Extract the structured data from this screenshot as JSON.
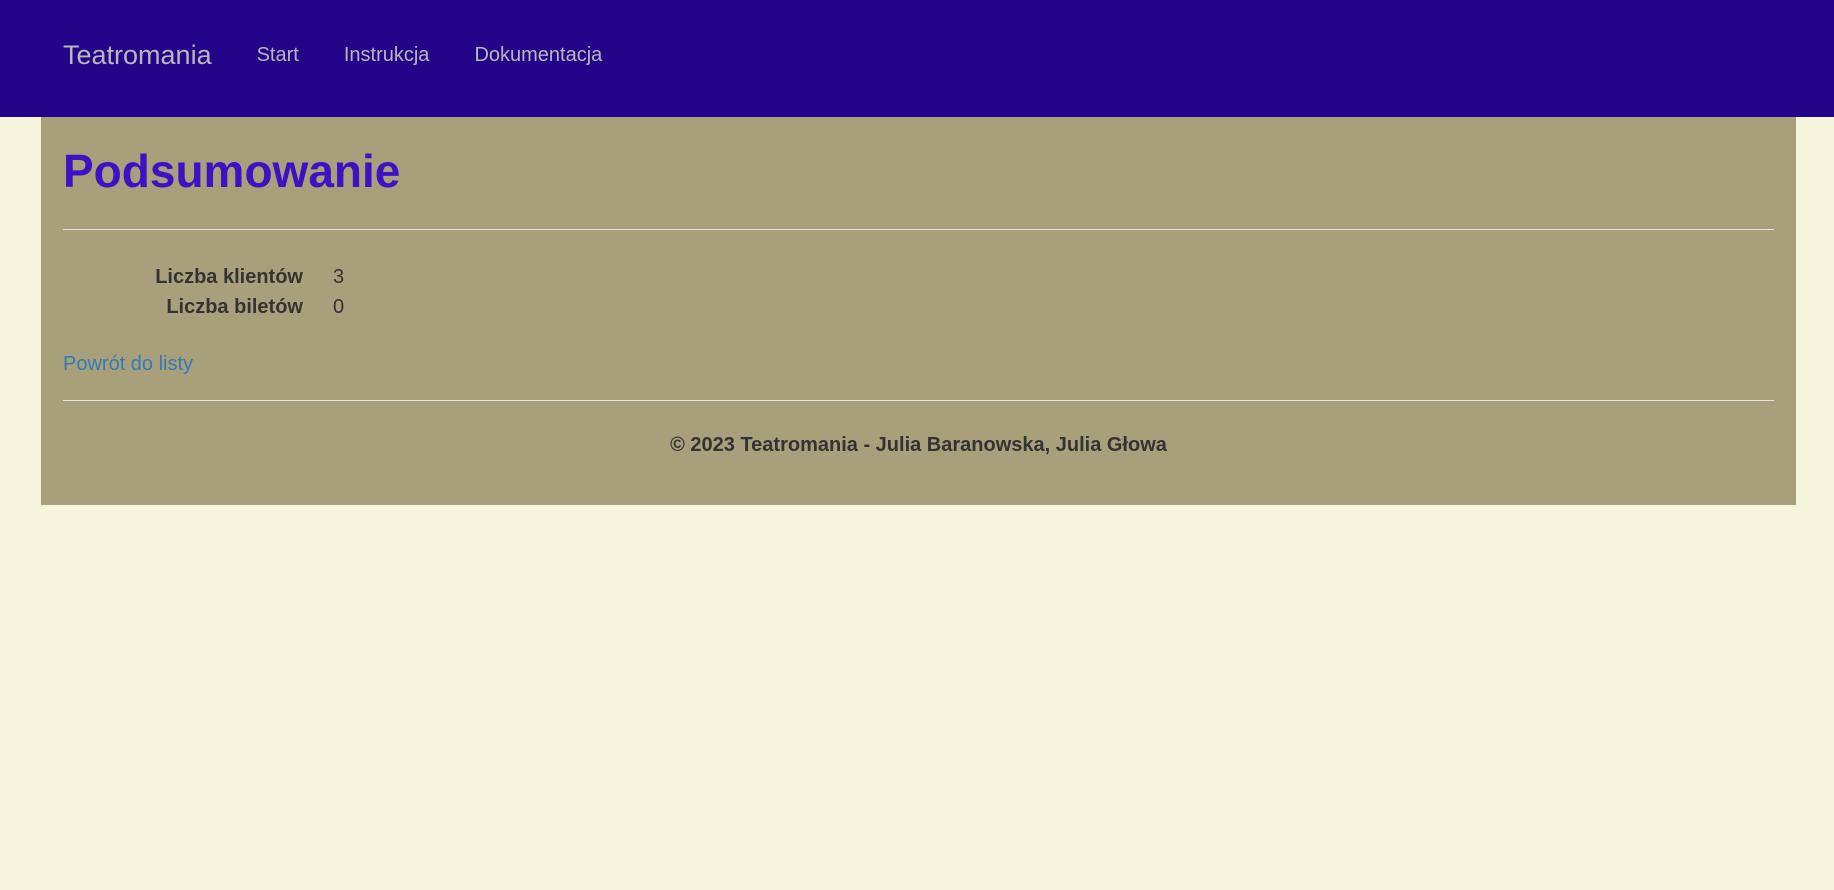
{
  "navbar": {
    "brand": "Teatromania",
    "links": [
      "Start",
      "Instrukcja",
      "Dokumentacja"
    ]
  },
  "main": {
    "title": "Podsumowanie",
    "details": [
      {
        "label": "Liczba klientów",
        "value": "3"
      },
      {
        "label": "Liczba biletów",
        "value": "0"
      }
    ],
    "back_link": "Powrót do listy"
  },
  "footer": {
    "text": "© 2023 Teatromania - Julia Baranowska, Julia Głowa"
  },
  "colors": {
    "navbar_bg": "#220589",
    "page_bg": "#f5f5dc",
    "content_bg": "#a8a07a",
    "title": "#3b12c4",
    "link": "#337ab7"
  }
}
